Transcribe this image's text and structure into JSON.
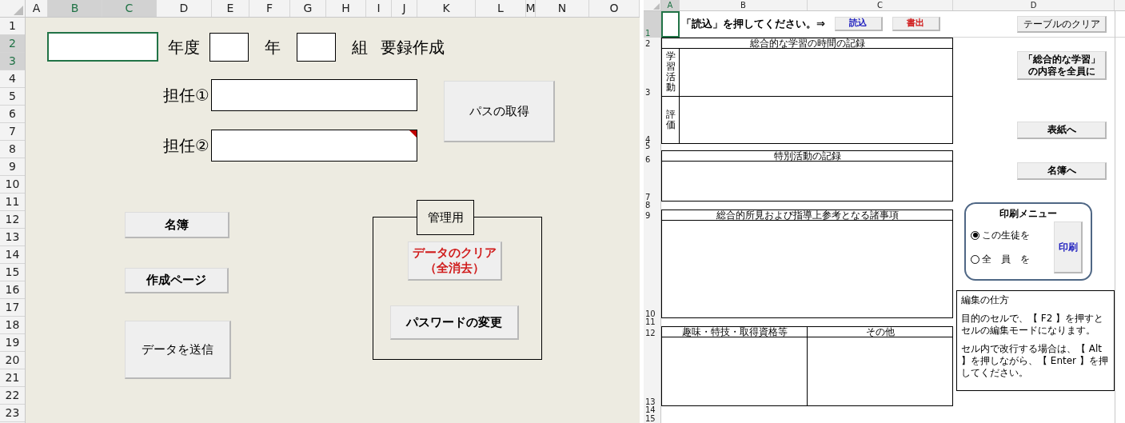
{
  "left_sheet": {
    "columns": [
      {
        "label": "A",
        "selected": false
      },
      {
        "label": "B",
        "selected": true
      },
      {
        "label": "C",
        "selected": true
      },
      {
        "label": "D",
        "selected": false
      },
      {
        "label": "E",
        "selected": false
      },
      {
        "label": "F",
        "selected": false
      },
      {
        "label": "G",
        "selected": false
      },
      {
        "label": "H",
        "selected": false
      },
      {
        "label": "I",
        "selected": false
      },
      {
        "label": "J",
        "selected": false
      },
      {
        "label": "K",
        "selected": false
      },
      {
        "label": "L",
        "selected": false
      },
      {
        "label": "M",
        "selected": false
      },
      {
        "label": "N",
        "selected": false
      },
      {
        "label": "O",
        "selected": false
      }
    ],
    "rows": [
      {
        "label": "1",
        "selected": false
      },
      {
        "label": "2",
        "selected": true
      },
      {
        "label": "3",
        "selected": true
      },
      {
        "label": "4",
        "selected": false
      },
      {
        "label": "5",
        "selected": false
      },
      {
        "label": "6",
        "selected": false
      },
      {
        "label": "7",
        "selected": false
      },
      {
        "label": "8",
        "selected": false
      },
      {
        "label": "9",
        "selected": false
      },
      {
        "label": "10",
        "selected": false
      },
      {
        "label": "11",
        "selected": false
      },
      {
        "label": "12",
        "selected": false
      },
      {
        "label": "13",
        "selected": false
      },
      {
        "label": "14",
        "selected": false
      },
      {
        "label": "15",
        "selected": false
      },
      {
        "label": "16",
        "selected": false
      },
      {
        "label": "17",
        "selected": false
      },
      {
        "label": "18",
        "selected": false
      },
      {
        "label": "19",
        "selected": false
      },
      {
        "label": "20",
        "selected": false
      },
      {
        "label": "21",
        "selected": false
      },
      {
        "label": "22",
        "selected": false
      },
      {
        "label": "23",
        "selected": false
      }
    ],
    "header_form": {
      "year_field": {
        "selected": true
      },
      "year_label": "年度",
      "grade_label": "年",
      "class_label": "組",
      "title": "要録作成"
    },
    "teachers": [
      {
        "label": "担任①",
        "has_comment": false
      },
      {
        "label": "担任②",
        "has_comment": true
      }
    ],
    "path_button": "パスの取得",
    "nav_buttons": [
      "名簿",
      "作成ページ",
      "データを送信"
    ],
    "admin": {
      "label": "管理用",
      "buttons": [
        {
          "lines": [
            "データのクリア",
            "（全消去）"
          ],
          "kind": "danger"
        },
        {
          "lines": [
            "パスワードの変更"
          ],
          "kind": "normal"
        }
      ]
    }
  },
  "right_sheet": {
    "columns": [
      {
        "label": "A",
        "selected": true
      },
      {
        "label": "B",
        "selected": false
      },
      {
        "label": "C",
        "selected": false
      },
      {
        "label": "D",
        "selected": false
      }
    ],
    "rows": [
      {
        "label": "1",
        "selected": true
      },
      {
        "label": "2",
        "selected": false
      },
      {
        "label": "3",
        "selected": false
      },
      {
        "label": "4",
        "selected": false
      },
      {
        "label": "5",
        "selected": false
      },
      {
        "label": "6",
        "selected": false
      },
      {
        "label": "7",
        "selected": false
      },
      {
        "label": "8",
        "selected": false
      },
      {
        "label": "9",
        "selected": false
      },
      {
        "label": "10",
        "selected": false
      },
      {
        "label": "11",
        "selected": false
      },
      {
        "label": "12",
        "selected": false
      },
      {
        "label": "13",
        "selected": false
      },
      {
        "label": "14",
        "selected": false
      },
      {
        "label": "15",
        "selected": false
      }
    ],
    "instruction": "「読込」を押してください。⇒",
    "file_buttons": [
      {
        "label": "読込",
        "kind": "load"
      },
      {
        "label": "書出",
        "kind": "export"
      }
    ],
    "clear_table_button": "テーブルのクリア",
    "integrated_study": {
      "title": "総合的な学習の時間の記録",
      "row_labels": [
        "学習活動",
        "評価"
      ]
    },
    "special_activities": {
      "title": "特別活動の記録"
    },
    "overall_remarks": {
      "title": "総合的所見および指導上参考となる諸事項"
    },
    "other_records": {
      "columns": [
        "趣味・特技・取得資格等",
        "その他"
      ]
    },
    "side_buttons": [
      {
        "lines": [
          "「総合的な学習」",
          "の内容を全員に"
        ]
      },
      {
        "lines": [
          "表紙へ"
        ]
      },
      {
        "lines": [
          "名簿へ"
        ]
      }
    ],
    "print_menu": {
      "title": "印刷メニュー",
      "options": [
        {
          "label": "この生徒を",
          "selected": true
        },
        {
          "label": "全　員　を",
          "selected": false
        }
      ],
      "button": "印刷"
    },
    "help": {
      "title": "編集の仕方",
      "paragraphs": [
        "目的のセルで、【 F2 】を押すとセルの編集モードになります。",
        "セル内で改行する場合は、【 Alt 】を押しながら、【 Enter 】を押してください。"
      ]
    }
  }
}
